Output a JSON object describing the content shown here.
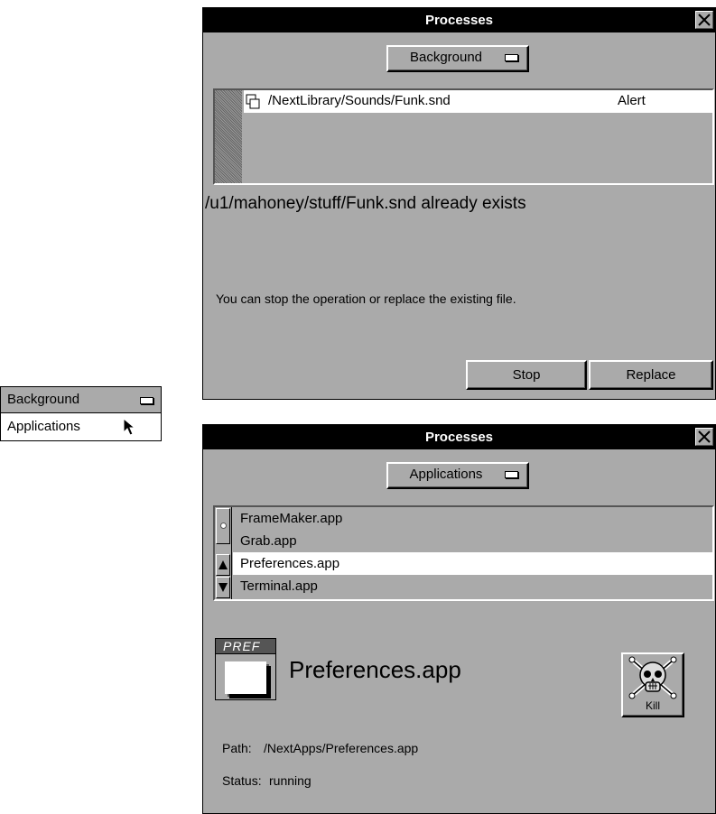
{
  "popup_menu": {
    "items": [
      "Background",
      "Applications"
    ]
  },
  "window1": {
    "title": "Processes",
    "popup_label": "Background",
    "list": [
      {
        "path": "/NextLibrary/Sounds/Funk.snd",
        "status": "Alert"
      }
    ],
    "message": "/u1/mahoney/stuff/Funk.snd already exists",
    "hint": "You can stop the operation or replace the existing file.",
    "stop_label": "Stop",
    "replace_label": "Replace"
  },
  "window2": {
    "title": "Processes",
    "popup_label": "Applications",
    "apps": [
      "FrameMaker.app",
      "Grab.app",
      "Preferences.app",
      "Terminal.app"
    ],
    "selected_index": 2,
    "app_icon_text": "PREF",
    "app_name": "Preferences.app",
    "kill_label": "Kill",
    "path_label": "Path:",
    "path_value": "/NextApps/Preferences.app",
    "status_label": "Status:",
    "status_value": "running"
  }
}
